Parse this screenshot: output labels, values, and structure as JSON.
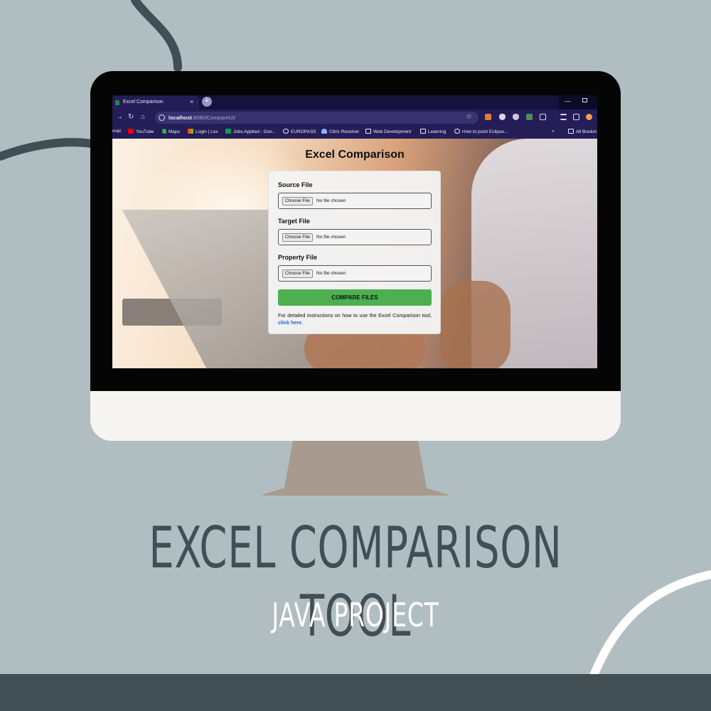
{
  "browser": {
    "tab_title": "Excel Comparison",
    "tab_close": "×",
    "new_tab": "+",
    "url_host": "localhost",
    "url_path": ":8080/CompareUI/",
    "bookmarks": [
      "mail",
      "YouTube",
      "Maps",
      "Login | Lex",
      "Jobs Applied - Goo...",
      "EUROPASS",
      "Citrix Receiver",
      "Web Development",
      "Learning",
      "How to push Eclipse...",
      "»",
      "All Bookm"
    ]
  },
  "page": {
    "title": "Excel Comparison",
    "fields": [
      {
        "label": "Source File",
        "button": "Choose File",
        "status": "No file chosen"
      },
      {
        "label": "Target File",
        "button": "Choose File",
        "status": "No file chosen"
      },
      {
        "label": "Property File",
        "button": "Choose File",
        "status": "No file chosen"
      }
    ],
    "compare_button": "COMPARE FILES",
    "help_text": "For detailed instructions on how to use the Excel Comparison tool,",
    "help_link": "click here",
    "help_end": "."
  },
  "poster": {
    "title": "EXCEL COMPARISON TOOL",
    "subtitle": "JAVA PROJECT"
  },
  "colors": {
    "background": "#b0bec2",
    "dark_slate": "#414f54",
    "compare_button": "#4caf50",
    "link": "#1a63d6",
    "stand": "#a89a8e"
  }
}
